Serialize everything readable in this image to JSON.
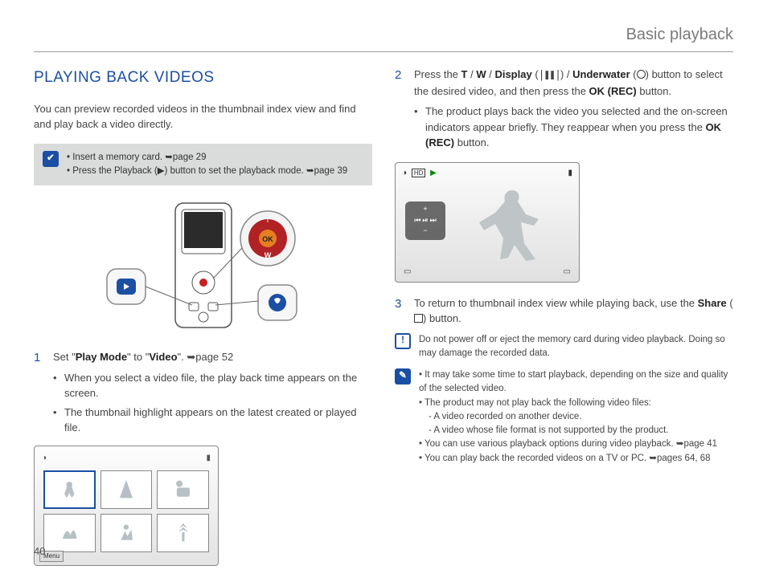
{
  "header": {
    "title": "Basic playback"
  },
  "pageNumber": "40",
  "left": {
    "sectionTitle": "PLAYING BACK VIDEOS",
    "intro": "You can preview recorded videos in the thumbnail index view and find and play back a video directly.",
    "preNote": {
      "items": [
        "Insert a memory card. ➥page 29",
        "Press the Playback (▶) button to set the playback mode. ➥page 39"
      ]
    },
    "step1": {
      "num": "1",
      "text_a": "Set \"",
      "bold_a": "Play Mode",
      "text_b": "\" to \"",
      "bold_b": "Video",
      "text_c": "\". ➥page 52",
      "bullets": [
        "When you select a video file, the play back time appears on the screen.",
        "The thumbnail highlight appears on the latest created or played file."
      ]
    },
    "thumbPanel": {
      "footer": "Menu"
    }
  },
  "right": {
    "step2": {
      "num": "2",
      "line": "Press the T / W / Display (❙ ❙) / Underwater (◯) button to select the desired video, and then press the OK (REC) button.",
      "bullets": [
        "The product plays back the video you selected and the on-screen indicators appear briefly. They reappear when you press the OK (REC) button."
      ]
    },
    "playPanel": {
      "topLeft": "HD",
      "playIcon": "▶",
      "batt": "▮",
      "ctrlPlus": "+",
      "ctrlMinus": "−",
      "ctrlPrev": "⏮",
      "ctrlPlay": "⏯",
      "ctrlNext": "⏭"
    },
    "step3": {
      "num": "3",
      "line": "To return to thumbnail index view while playing back, use the Share (⫶) button."
    },
    "warn": "Do not power off or eject the memory card during video playback. Doing so may damage the recorded data.",
    "notes": [
      "It may take some time to start playback, depending on the size and quality of the selected video.",
      "The product may not play back the following video files:",
      "You can use various playback options during video playback. ➥page 41",
      "You can play back the recorded videos on a TV or PC. ➥pages 64, 68"
    ],
    "notesSub": [
      "A video recorded on another device.",
      "A video whose file format is not supported by the product."
    ]
  }
}
